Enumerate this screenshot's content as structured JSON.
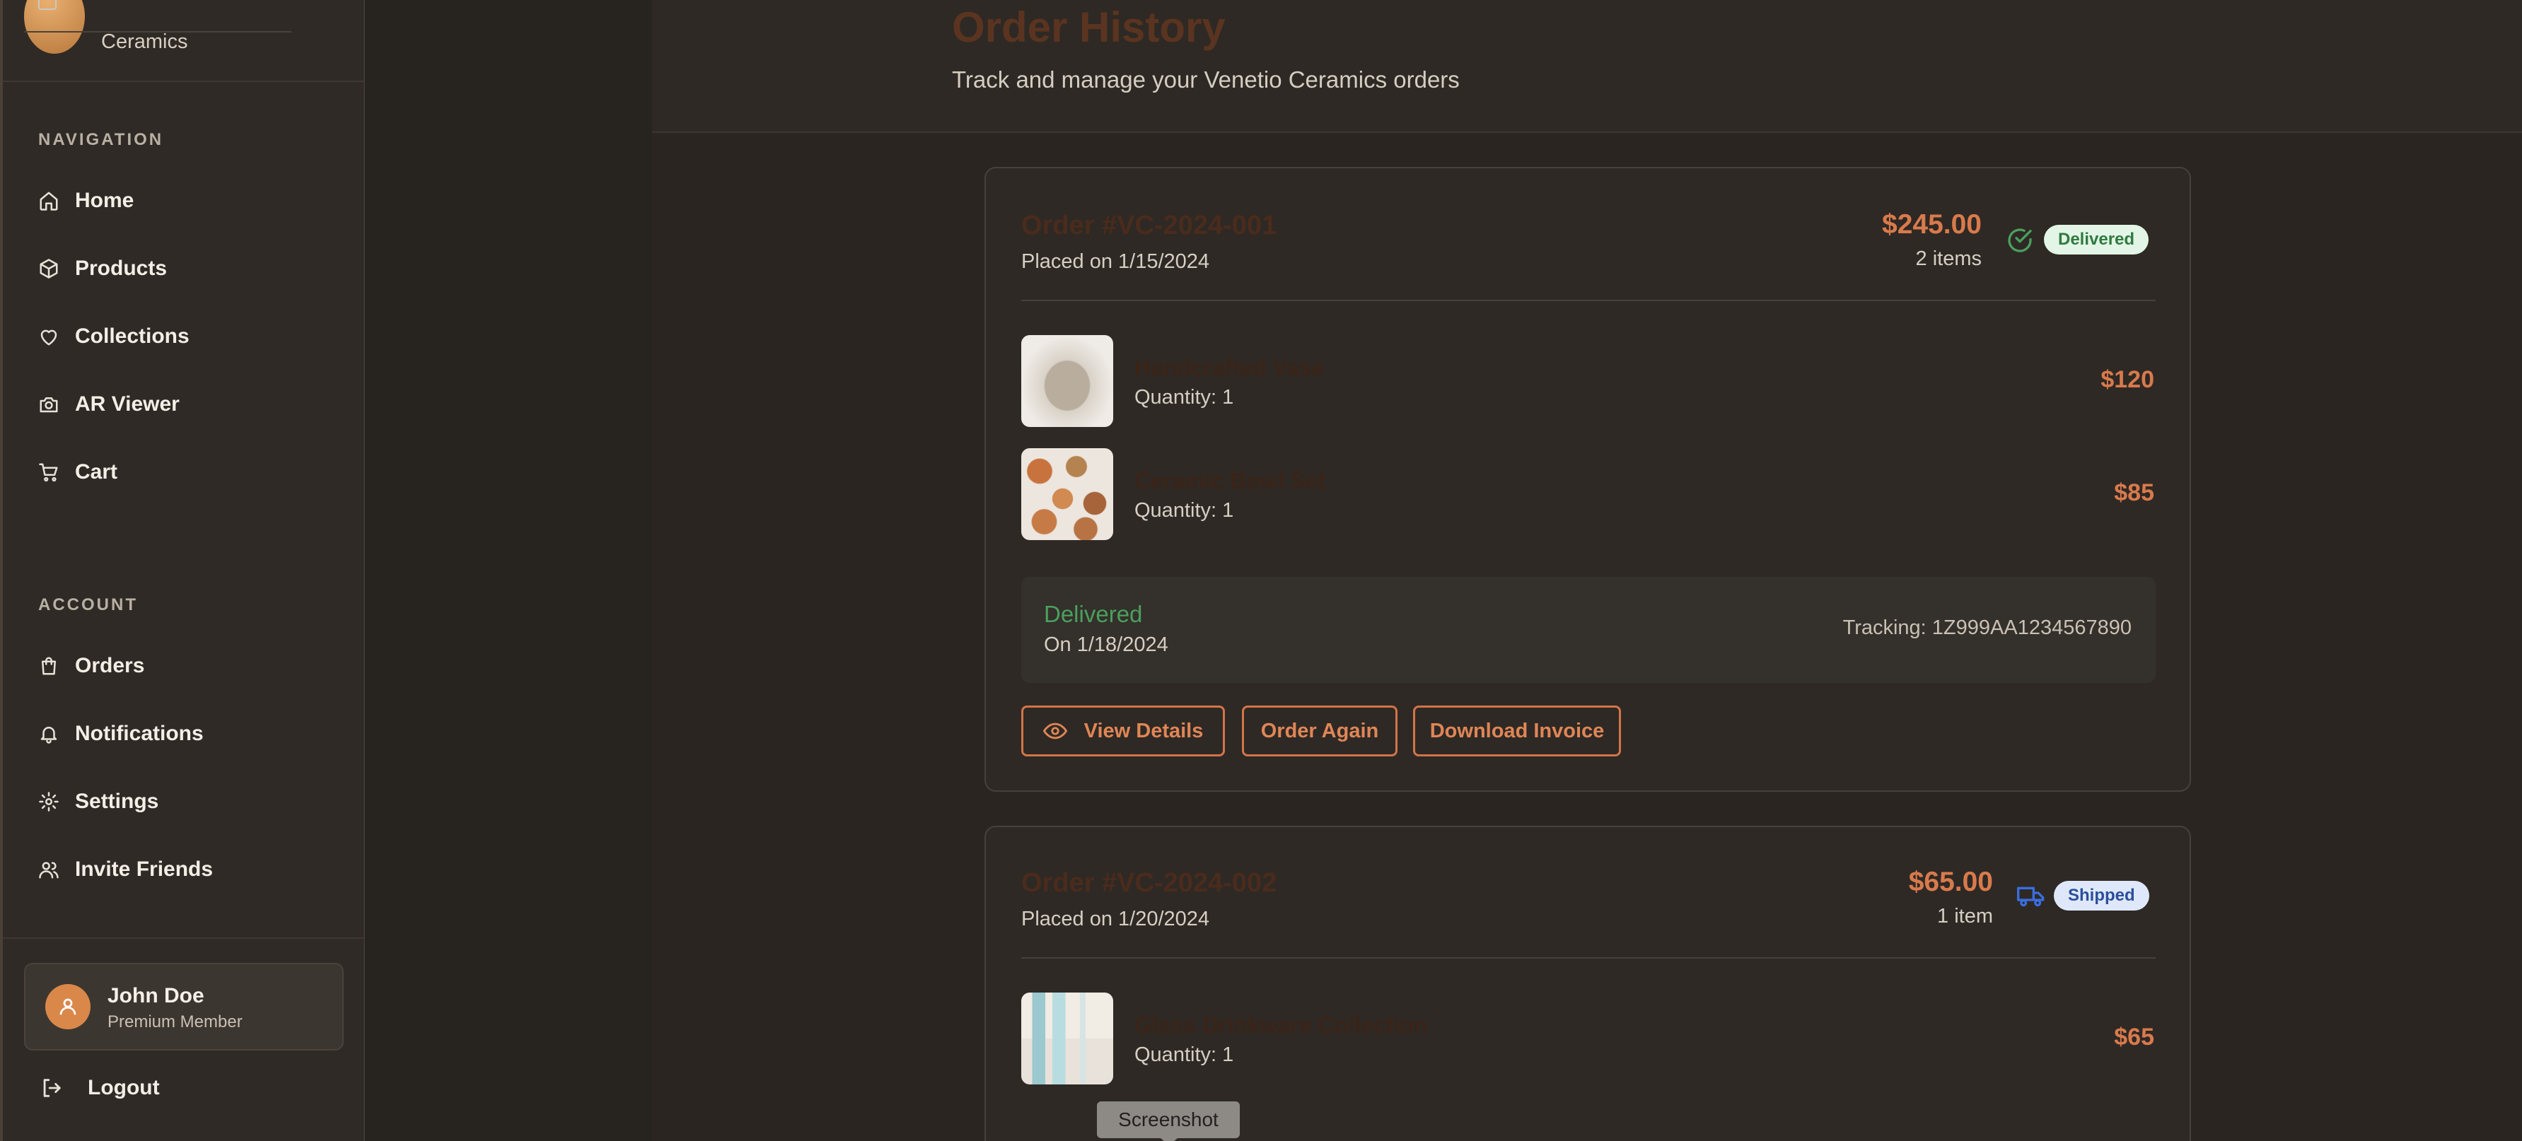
{
  "brand": {
    "name": "Ceramics"
  },
  "sidebar": {
    "navigation_label": "NAVIGATION",
    "nav_items": [
      {
        "label": "Home",
        "icon": "home-icon"
      },
      {
        "label": "Products",
        "icon": "box-icon"
      },
      {
        "label": "Collections",
        "icon": "heart-icon"
      },
      {
        "label": "AR Viewer",
        "icon": "camera-icon"
      },
      {
        "label": "Cart",
        "icon": "cart-icon"
      }
    ],
    "account_label": "ACCOUNT",
    "account_items": [
      {
        "label": "Orders",
        "icon": "shopping-bag-icon"
      },
      {
        "label": "Notifications",
        "icon": "bell-icon"
      },
      {
        "label": "Settings",
        "icon": "gear-icon"
      },
      {
        "label": "Invite Friends",
        "icon": "users-icon"
      }
    ],
    "user": {
      "name": "John Doe",
      "role": "Premium Member"
    },
    "logout_label": "Logout"
  },
  "header": {
    "title": "Order History",
    "subtitle": "Track and manage your Venetio Ceramics orders"
  },
  "orders": [
    {
      "id": "Order #VC-2024-001",
      "placed": "Placed on 1/15/2024",
      "total": "$245.00",
      "count": "2 items",
      "status": "Delivered",
      "items": [
        {
          "name": "Handcrafted Vase",
          "qty": "Quantity: 1",
          "price": "$120"
        },
        {
          "name": "Ceramic Bowl Set",
          "qty": "Quantity: 1",
          "price": "$85"
        }
      ],
      "delivery": {
        "status": "Delivered",
        "date": "On 1/18/2024",
        "tracking": "Tracking: 1Z999AA1234567890"
      },
      "actions": {
        "view": "View Details",
        "again": "Order Again",
        "invoice": "Download Invoice"
      }
    },
    {
      "id": "Order #VC-2024-002",
      "placed": "Placed on 1/20/2024",
      "total": "$65.00",
      "count": "1 item",
      "status": "Shipped",
      "items": [
        {
          "name": "Glass Drinkware Collection",
          "qty": "Quantity: 1",
          "price": "$65"
        }
      ]
    }
  ],
  "tooltip": "Screenshot",
  "colors": {
    "accent": "#d97a4c",
    "delivered": "#4aa05d",
    "shipped": "#3a6ee0"
  }
}
